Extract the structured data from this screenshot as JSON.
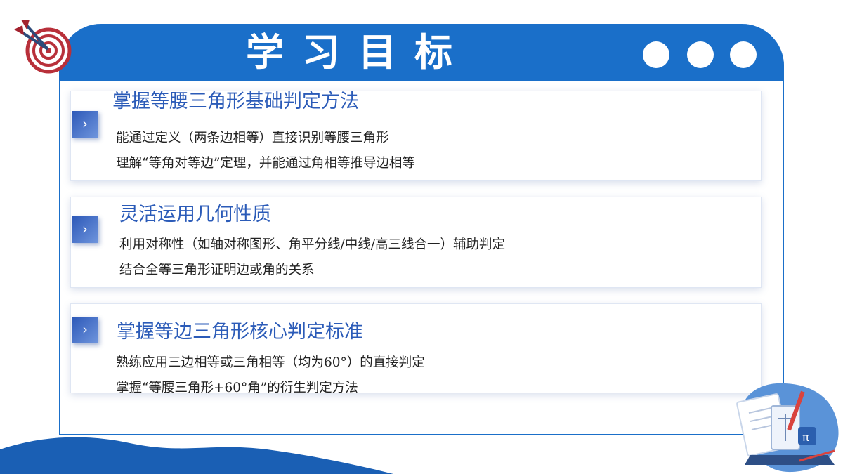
{
  "slide": {
    "title": "学习目标",
    "accent_color": "#1a6fc9",
    "heading_color": "#2b5bb8",
    "icons": [
      "dart-target-icon",
      "chevron-right-icon",
      "math-books-illustration"
    ]
  },
  "objectives": [
    {
      "heading": "掌握等腰三角形基础判定方法",
      "lines": [
        "能通过定义（两条边相等）直接识别等腰三角形",
        "理解“等角对等边”定理，并能通过角相等推导边相等"
      ]
    },
    {
      "heading": "灵活运用几何性质",
      "lines": [
        "利用对称性（如轴对称图形、角平分线/中线/高三线合一）辅助判定",
        "结合全等三角形证明边或角的关系"
      ]
    },
    {
      "heading": "掌握等边三角形核心判定标准",
      "lines": [
        "熟练应用三边相等或三角相等（均为60°）的直接判定",
        "掌握“等腰三角形+60°角”的衍生判定方法"
      ]
    }
  ],
  "chevron_glyph": "›",
  "illustration_glyph": "π"
}
